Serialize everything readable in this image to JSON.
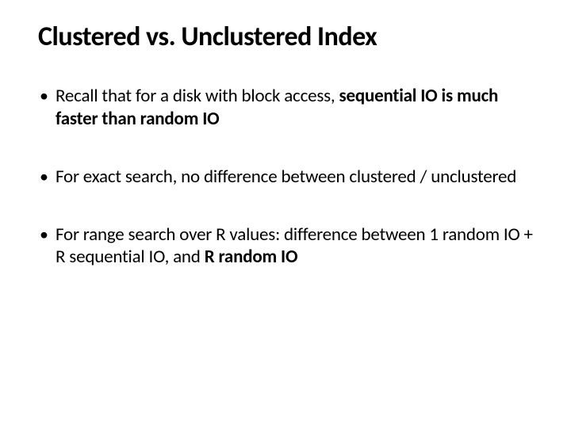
{
  "title": "Clustered vs. Unclustered Index",
  "bullets": [
    {
      "pre": "Recall that for a disk with block access, ",
      "bold1": "sequential IO is much faster than",
      "mid": " ",
      "bold2": "random IO",
      "post": ""
    },
    {
      "pre": "For exact search, no difference between clustered / unclustered",
      "bold1": "",
      "mid": "",
      "bold2": "",
      "post": ""
    },
    {
      "pre": "For range search over R values: difference between 1 random IO + R sequential IO, and ",
      "bold1": "R random IO",
      "mid": "",
      "bold2": "",
      "post": ""
    }
  ]
}
